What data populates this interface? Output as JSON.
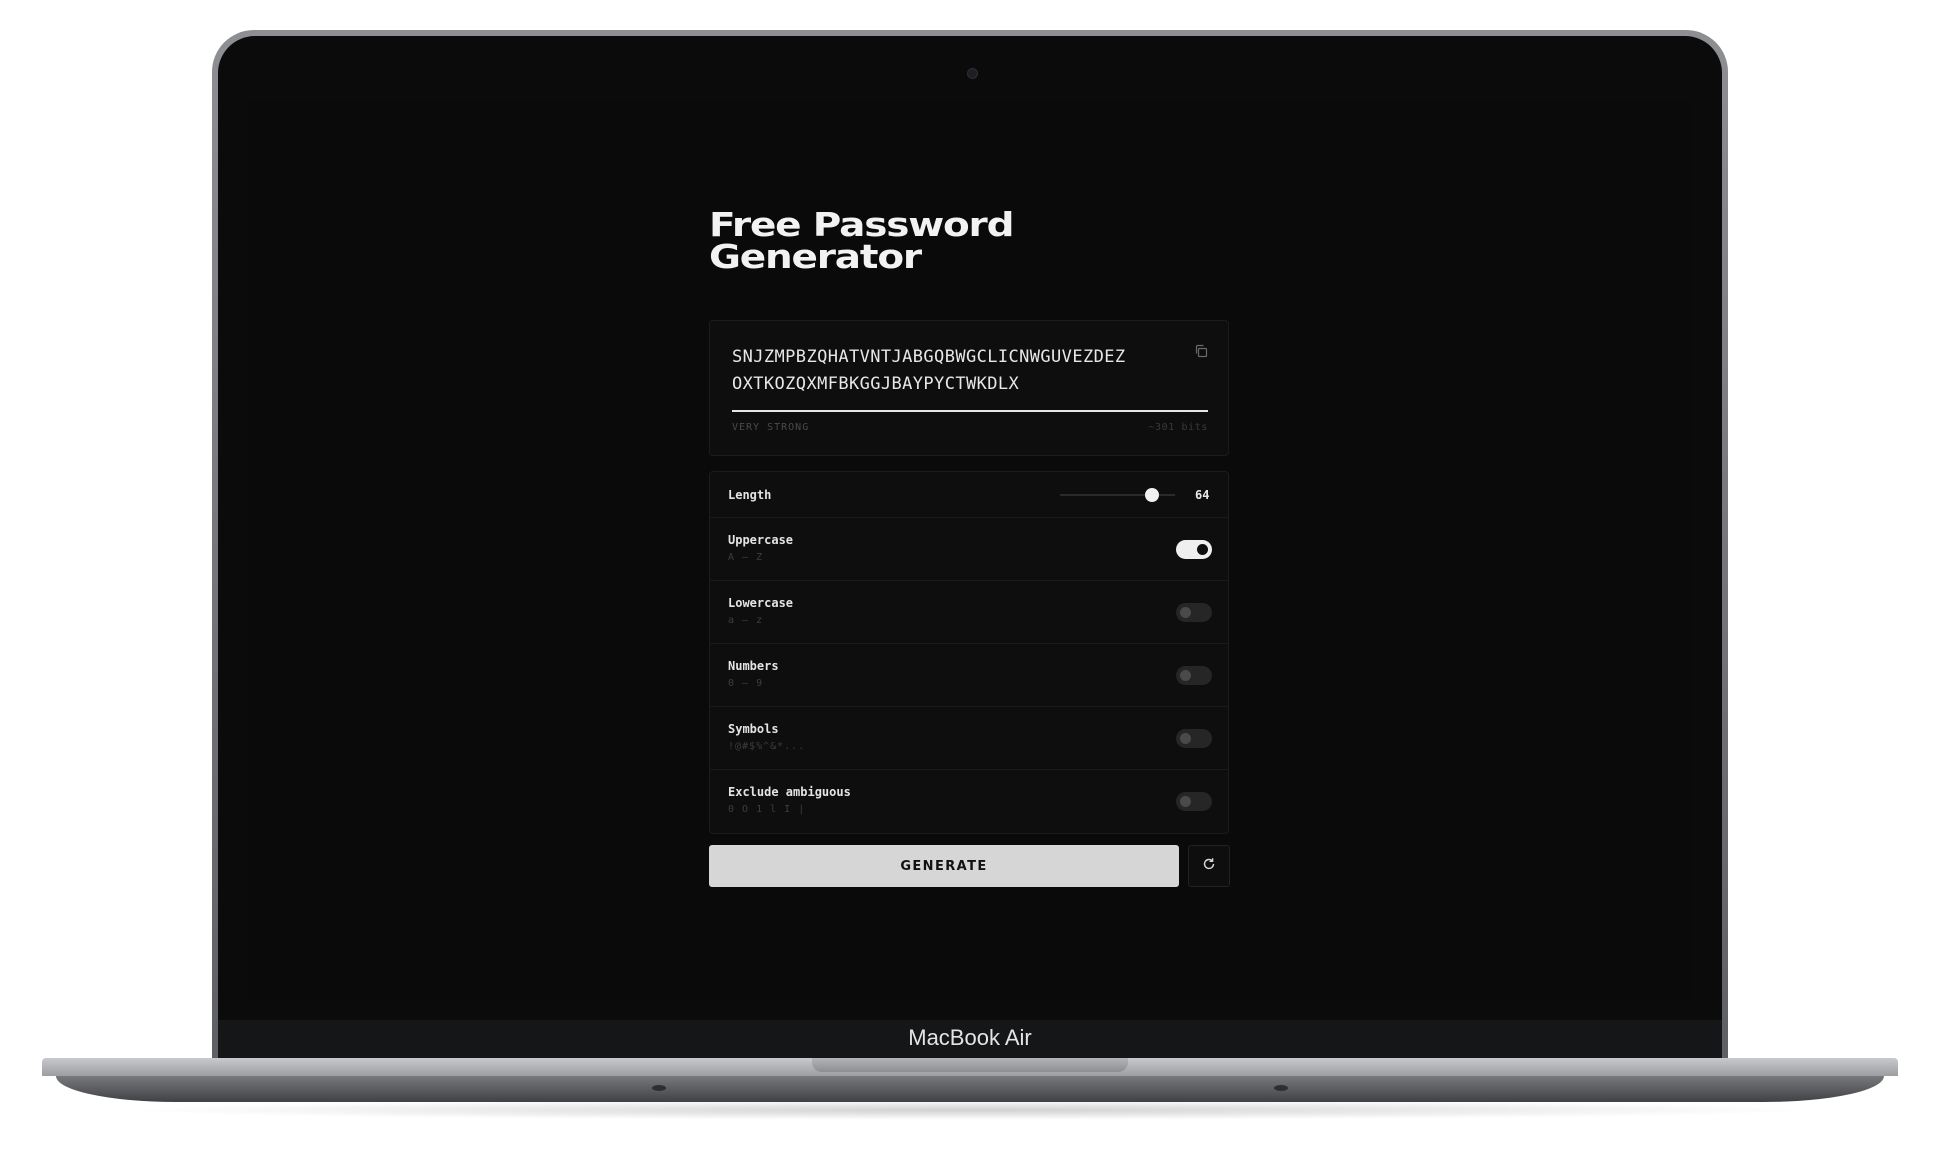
{
  "device": {
    "brand_label": "MacBook Air"
  },
  "app": {
    "title_line1": "Free Password",
    "title_line2": "Generator",
    "password_line1": "SNJZMPBZQHATVNTJABGQBWGCLICNWGUVEZDEZ",
    "password_line2": "OXTKOZQXMFBKGGJBAYPYCTWKDLX",
    "strength_label": "VERY STRONG",
    "entropy_label": "~301 bits",
    "length": {
      "label": "Length",
      "value": "64",
      "slider_fraction": 0.8
    },
    "options": [
      {
        "label": "Uppercase",
        "sub": "A – Z",
        "on": true
      },
      {
        "label": "Lowercase",
        "sub": "a – z",
        "on": false
      },
      {
        "label": "Numbers",
        "sub": "0 – 9",
        "on": false
      },
      {
        "label": "Symbols",
        "sub": "!@#$%^&*...",
        "on": false
      },
      {
        "label": "Exclude ambiguous",
        "sub": "0 O 1 l I |",
        "on": false
      }
    ],
    "generate_label": "GENERATE",
    "icons": {
      "copy": "copy-icon",
      "refresh": "refresh-icon"
    },
    "colors": {
      "background": "#0a0a0a",
      "accent": "#efefef",
      "button": "#d6d6d6"
    }
  }
}
